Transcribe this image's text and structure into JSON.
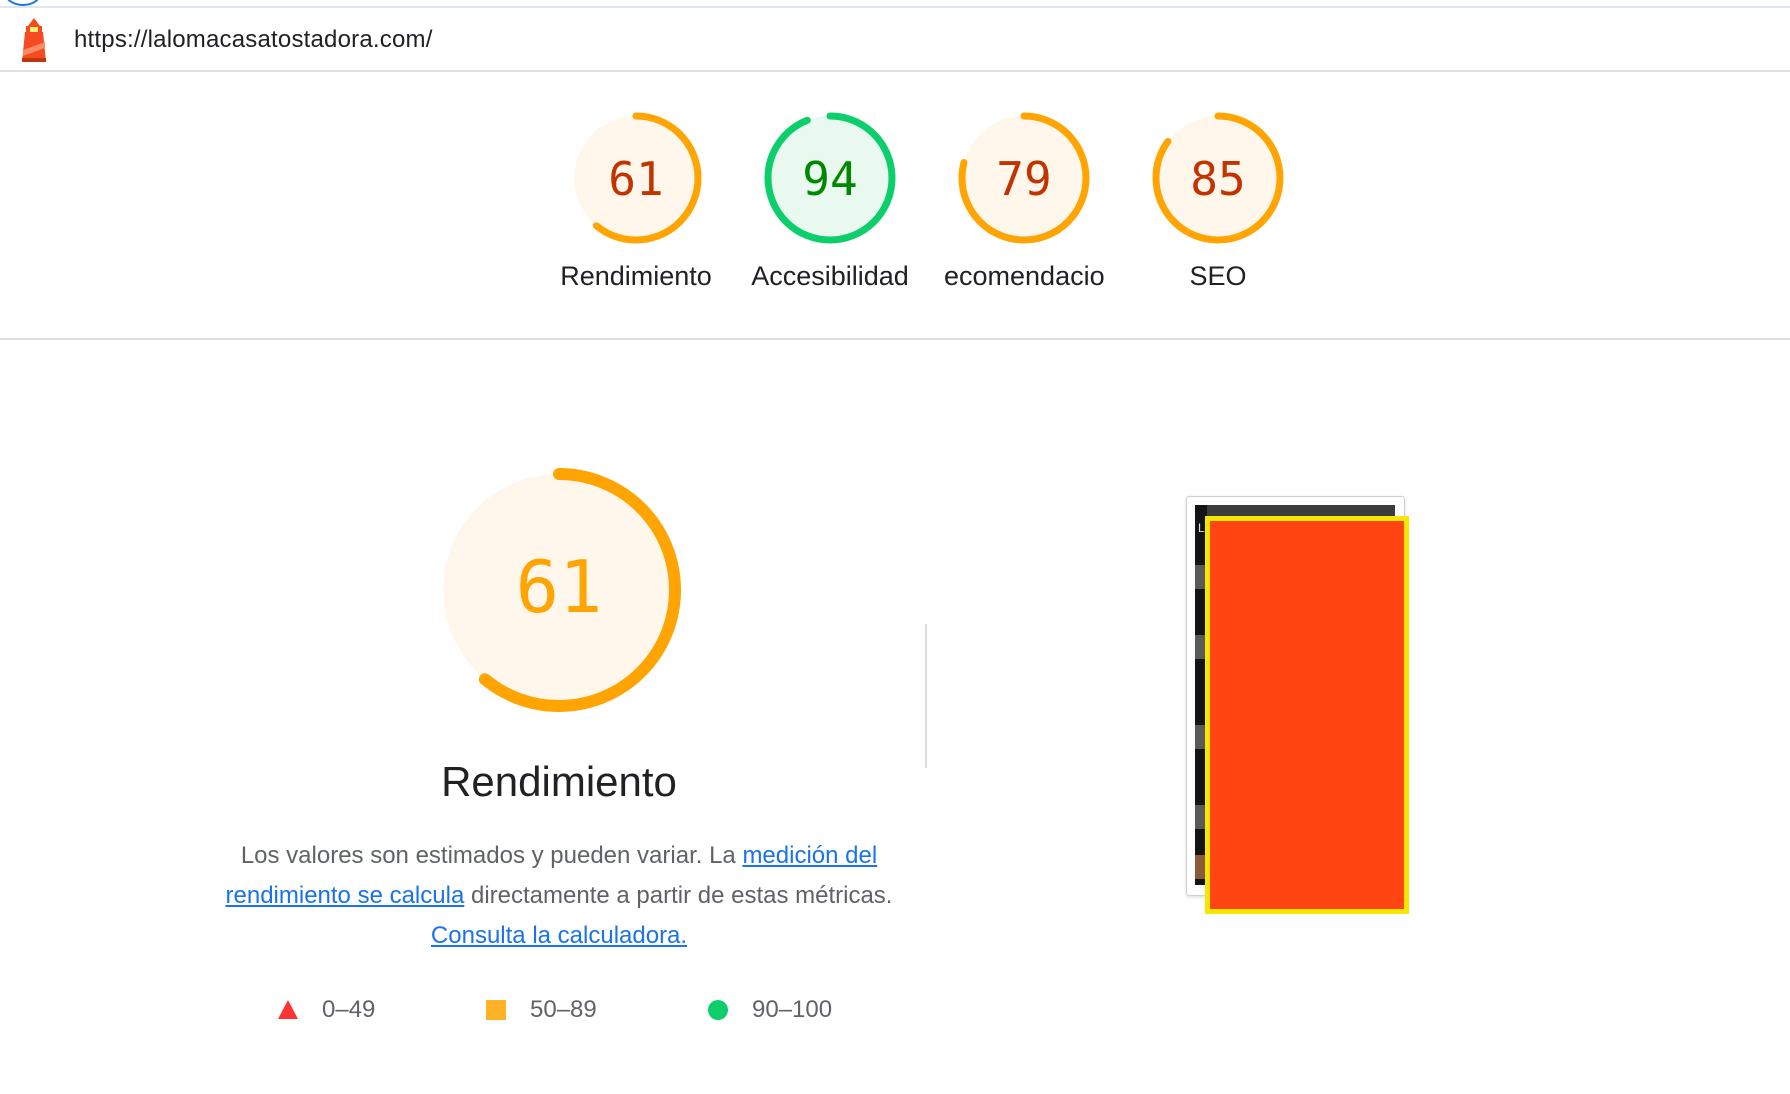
{
  "browser": {
    "url": "https://lalomacasatostadora.com/",
    "logo_icon": "lighthouse-icon"
  },
  "categories": [
    {
      "name": "Rendimiento",
      "score": 61,
      "label_shown": "Rendimiento",
      "status": "average"
    },
    {
      "name": "Accesibilidad",
      "score": 94,
      "label_shown": "Accesibilidad",
      "status": "pass"
    },
    {
      "name": "Prácticas recomendadas",
      "score": 79,
      "label_shown": "ecomendacione",
      "status": "average"
    },
    {
      "name": "SEO",
      "score": 85,
      "label_shown": "SEO",
      "status": "average"
    }
  ],
  "performance": {
    "score": 61,
    "score_text": "61",
    "title": "Rendimiento",
    "description": {
      "part1": "Los valores son estimados y pueden variar. La ",
      "link1": "medición del rendimiento se calcula",
      "part2": " directamente a partir de estas métricas. ",
      "link2": "Consulta la calculadora."
    },
    "legend": [
      {
        "icon": "triangle-fail-icon",
        "range": "0–49",
        "color": "#ff3333"
      },
      {
        "icon": "square-average-icon",
        "range": "50–89",
        "color": "#ffa400"
      },
      {
        "icon": "circle-pass-icon",
        "range": "90–100",
        "color": "#0cce6b"
      }
    ]
  },
  "screenshot": {
    "thumbnail_icon": "page-screenshot-thumbnail",
    "highlight_color": "#ff4512",
    "highlight_border": "#f6e600",
    "letter": "L"
  },
  "colors": {
    "average_stroke": "#ffa400",
    "average_fill": "#fff7ec",
    "average_text": "#c33300",
    "pass_stroke": "#0cce6b",
    "pass_fill": "#e9f9ef",
    "pass_text": "#008800"
  }
}
